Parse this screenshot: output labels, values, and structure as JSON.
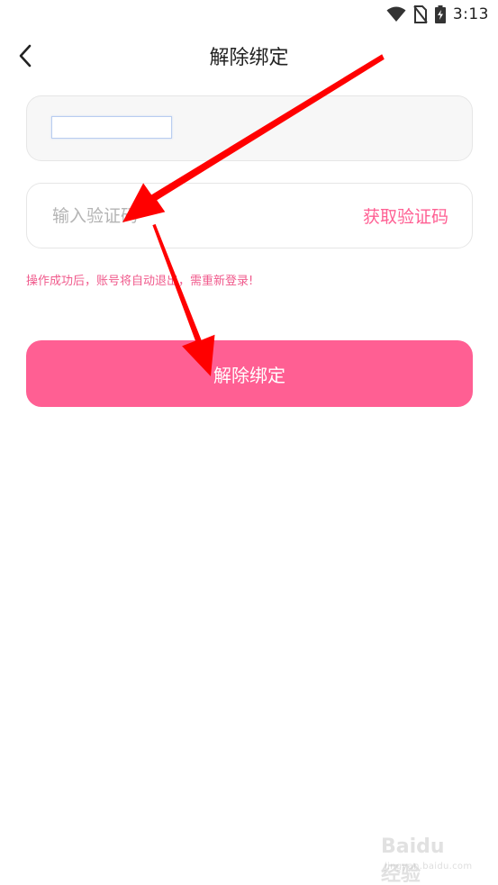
{
  "status_bar": {
    "time": "3:13",
    "icons": [
      "wifi-icon",
      "no-sim-icon",
      "battery-charging-icon"
    ]
  },
  "nav": {
    "back_icon": "chevron-left-icon",
    "title": "解除绑定"
  },
  "form": {
    "phone_value": "",
    "code_placeholder": "输入验证码",
    "code_value": "",
    "get_code_label": "获取验证码",
    "warning": "操作成功后，账号将自动退出，需重新登录!",
    "submit_label": "解除绑定"
  },
  "watermark": {
    "brand": "Baidu 经验",
    "sub": "jingyan.baidu.com"
  },
  "colors": {
    "accent": "#ff5f93",
    "warning_text": "#f05a8c",
    "annotation_arrow": "#ff0000",
    "field_border": "#e6e6e6",
    "field_fill": "#f7f7f7"
  }
}
